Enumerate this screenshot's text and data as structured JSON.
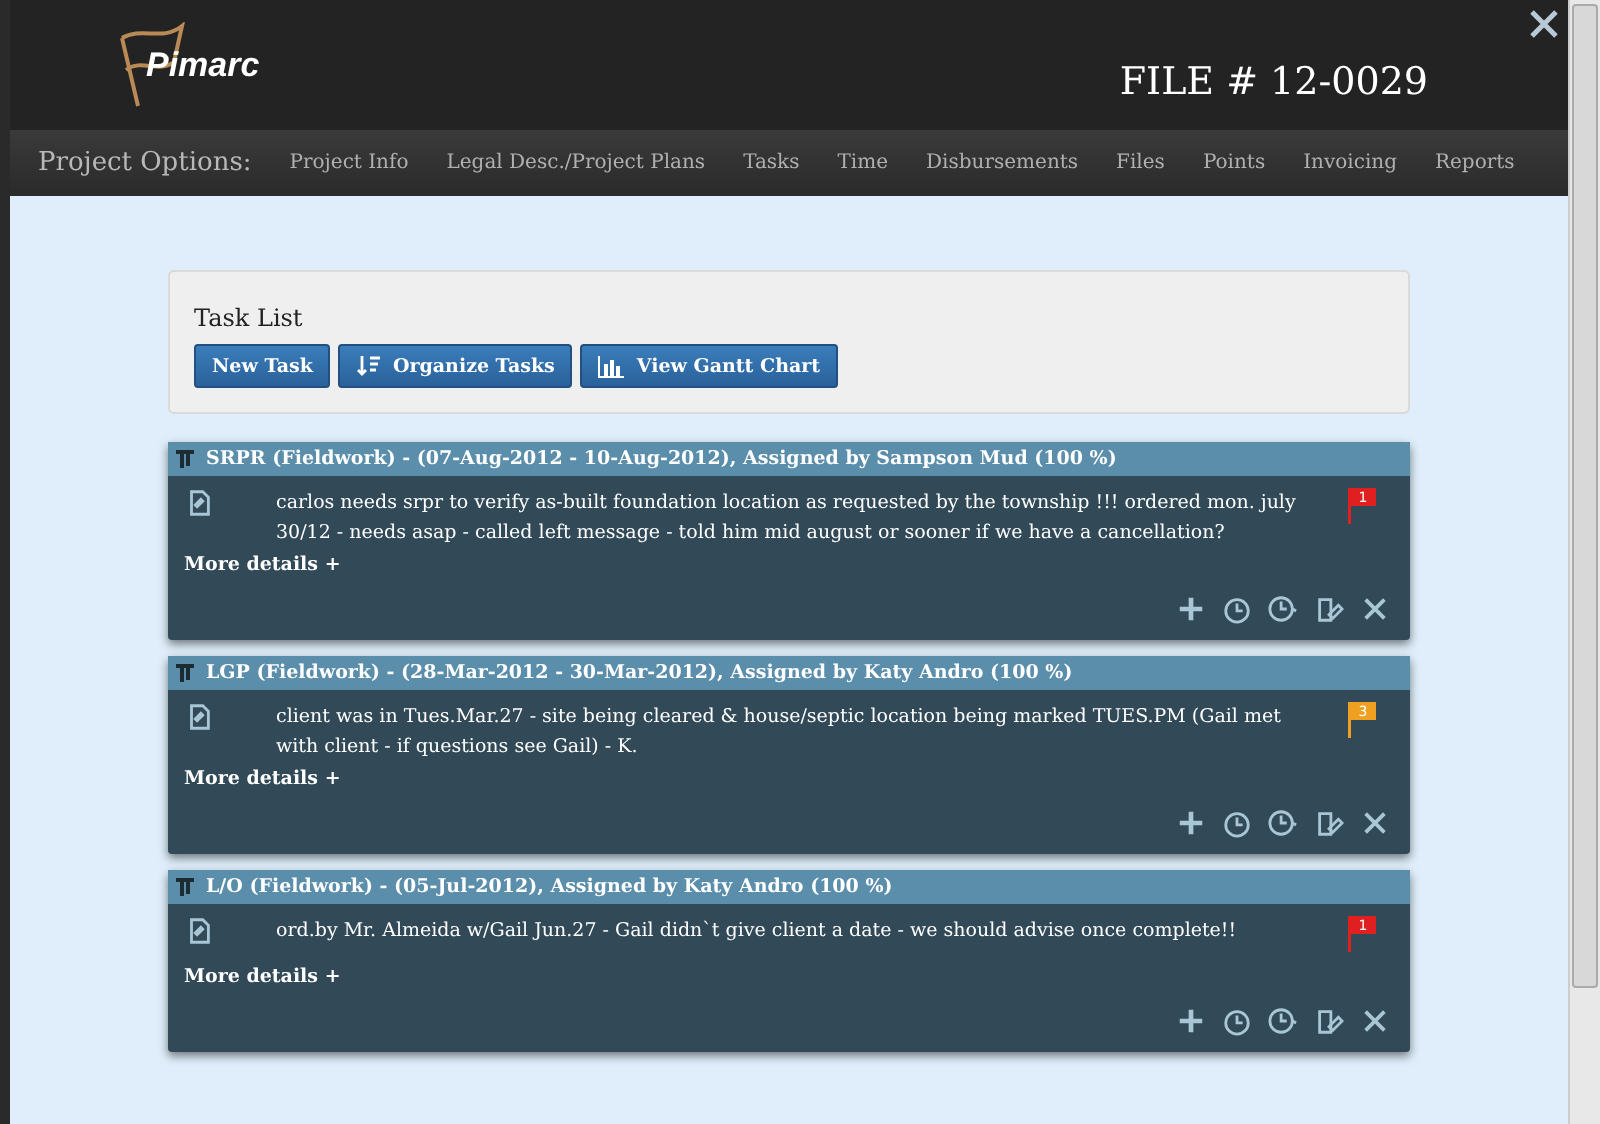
{
  "header": {
    "logo": "Pimarc",
    "file_number": "FILE # 12-0029"
  },
  "nav": {
    "label": "Project Options:",
    "items": [
      {
        "label": "Project Info"
      },
      {
        "label": "Legal Desc./Project Plans"
      },
      {
        "label": "Tasks"
      },
      {
        "label": "Time"
      },
      {
        "label": "Disbursements"
      },
      {
        "label": "Files"
      },
      {
        "label": "Points"
      },
      {
        "label": "Invoicing"
      },
      {
        "label": "Reports"
      }
    ]
  },
  "task_list": {
    "title": "Task List",
    "buttons": [
      {
        "label": "New Task",
        "kind": "plain"
      },
      {
        "label": "Organize Tasks",
        "kind": "sort"
      },
      {
        "label": "View Gantt Chart",
        "kind": "chart"
      }
    ]
  },
  "tasks": [
    {
      "title": "SRPR (Fieldwork) - (07-Aug-2012 - 10-Aug-2012), Assigned by Sampson Mud (100 %)",
      "note": "carlos needs srpr to verify as-built foundation location as requested by the township !!! ordered mon. july 30/12 - needs asap - called left message - told him mid august or sooner if we have a cancellation?",
      "flag": {
        "number": "1",
        "color": "#e02020"
      },
      "more": "More details +"
    },
    {
      "title": "LGP (Fieldwork) - (28-Mar-2012 - 30-Mar-2012), Assigned by Katy Andro (100 %)",
      "note": "client was in Tues.Mar.27 - site being cleared & house/septic location being marked TUES.PM (Gail met with client - if questions see Gail) - K.",
      "flag": {
        "number": "3",
        "color": "#f0a020"
      },
      "more": "More details +"
    },
    {
      "title": "L/O (Fieldwork) - (05-Jul-2012), Assigned by Katy Andro (100 %)",
      "note": "ord.by Mr. Almeida w/Gail Jun.27 - Gail didn`t give client a date - we should advise once complete!!",
      "flag": {
        "number": "1",
        "color": "#e02020"
      },
      "more": "More details +"
    }
  ]
}
